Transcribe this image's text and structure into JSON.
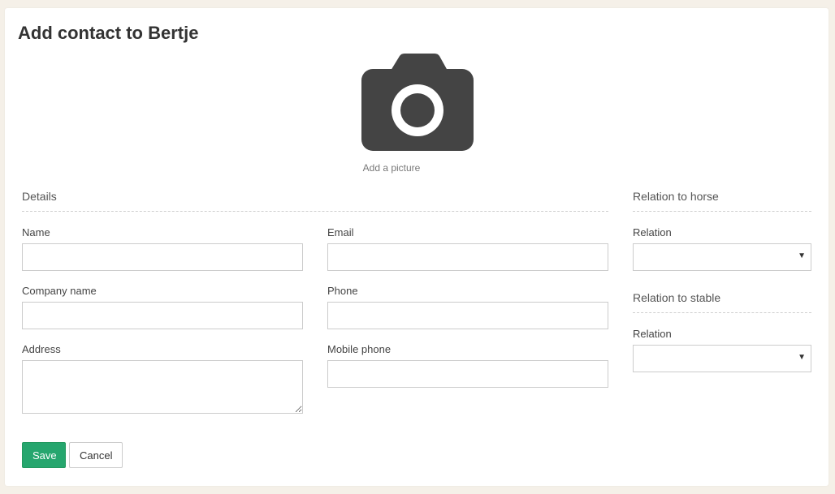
{
  "page": {
    "title": "Add contact to Bertje"
  },
  "picture": {
    "icon": "camera-icon",
    "caption": "Add a picture",
    "icon_color": "#444444"
  },
  "details": {
    "section_title": "Details",
    "fields": {
      "name": {
        "label": "Name",
        "value": ""
      },
      "company_name": {
        "label": "Company name",
        "value": ""
      },
      "address": {
        "label": "Address",
        "value": ""
      },
      "email": {
        "label": "Email",
        "value": ""
      },
      "phone": {
        "label": "Phone",
        "value": ""
      },
      "mobile_phone": {
        "label": "Mobile phone",
        "value": ""
      }
    }
  },
  "relation_to_horse": {
    "section_title": "Relation to horse",
    "label": "Relation",
    "selected": ""
  },
  "relation_to_stable": {
    "section_title": "Relation to stable",
    "label": "Relation",
    "selected": ""
  },
  "actions": {
    "save_label": "Save",
    "cancel_label": "Cancel",
    "save_color": "#26a66e"
  }
}
